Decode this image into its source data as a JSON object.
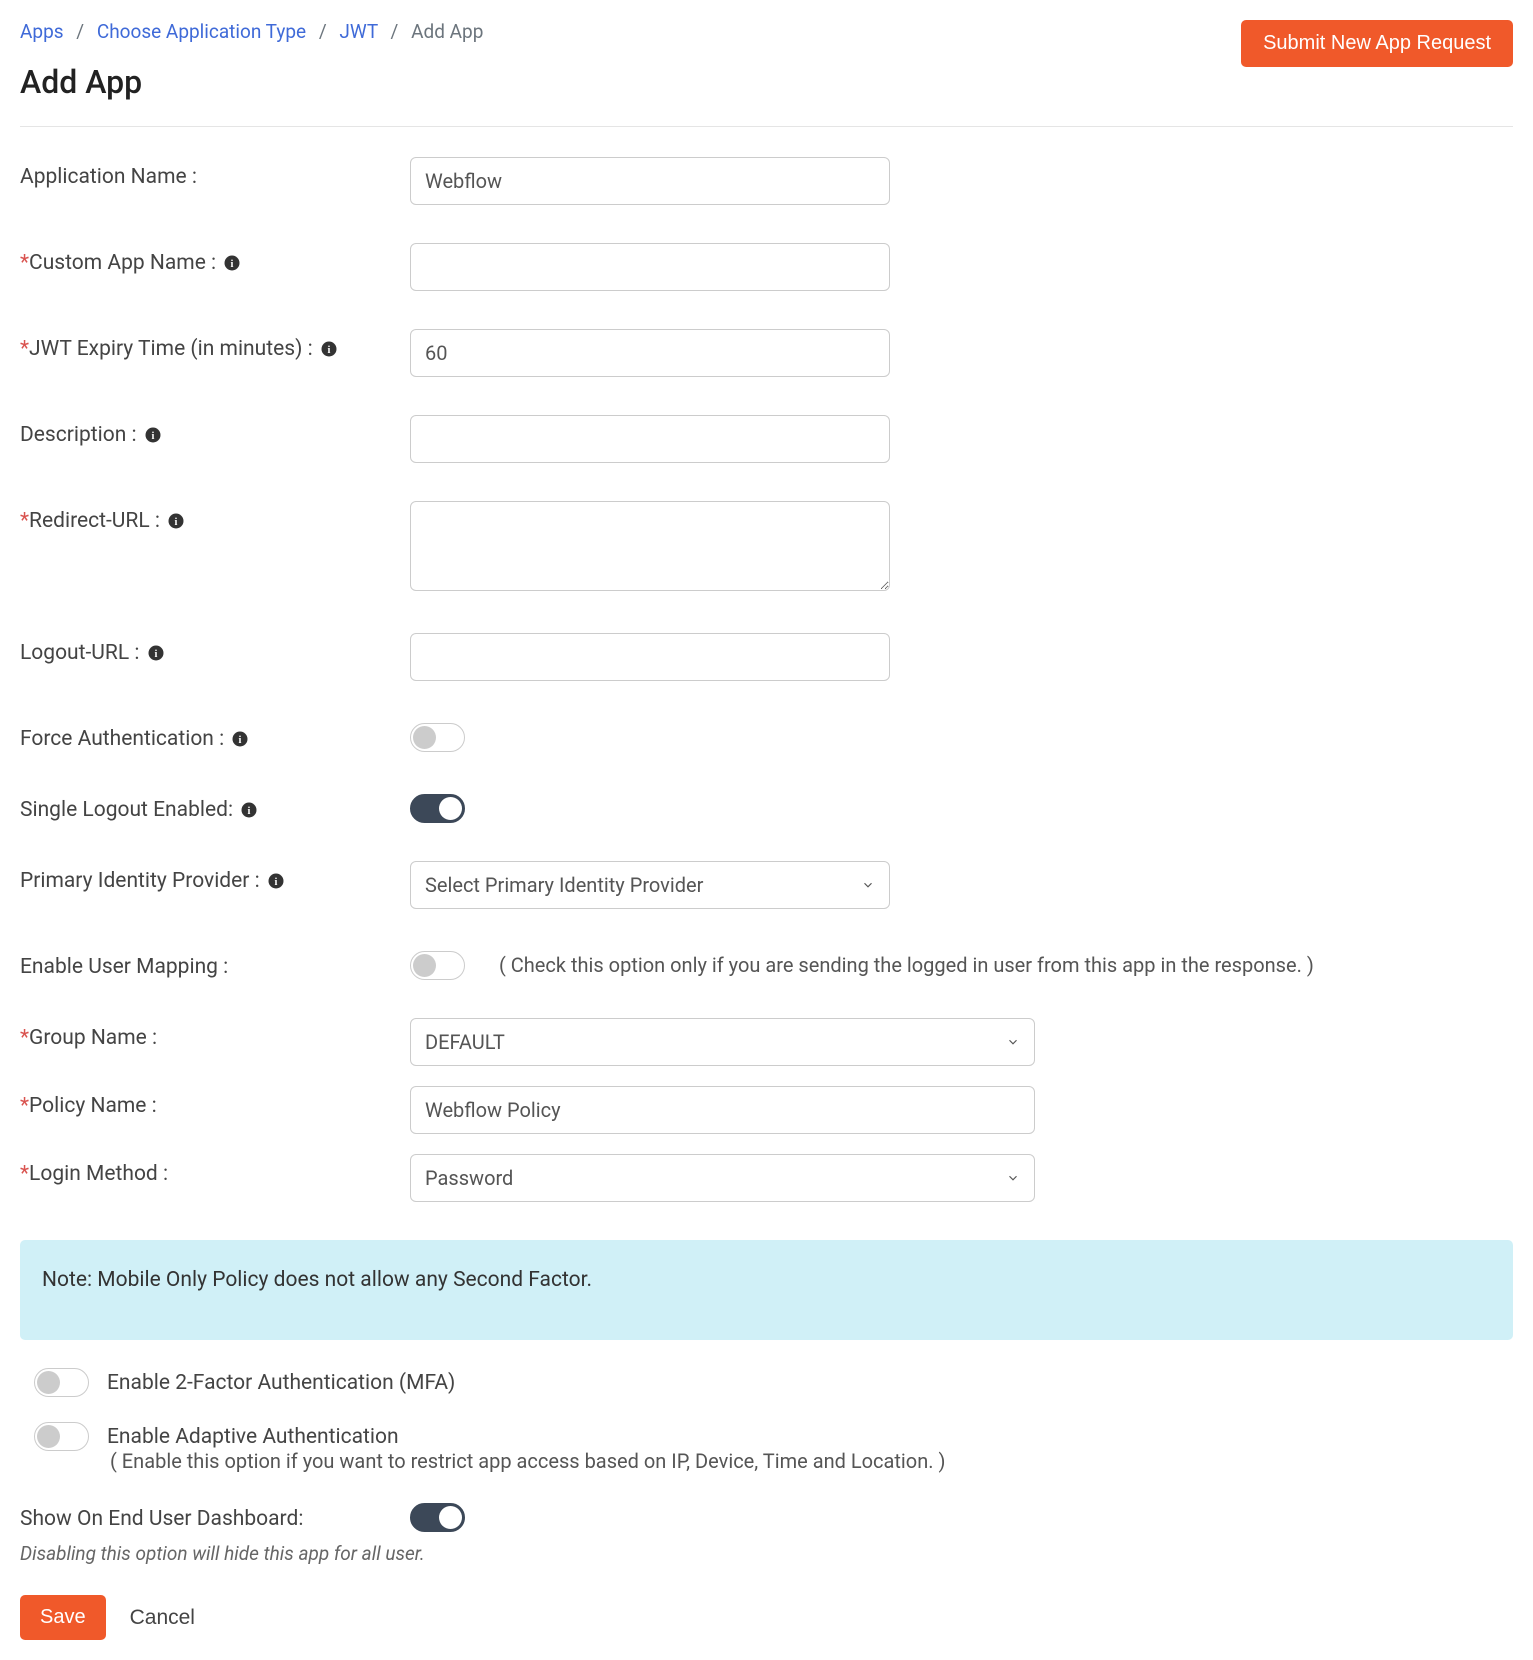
{
  "breadcrumb": {
    "apps": "Apps",
    "choose": "Choose Application Type",
    "jwt": "JWT",
    "current": "Add App"
  },
  "header": {
    "submit_btn": "Submit New App Request",
    "page_title": "Add App"
  },
  "form": {
    "app_name_label": "Application Name :",
    "app_name_value": "Webflow",
    "custom_app_name_label": "Custom App Name :",
    "custom_app_name_value": "",
    "jwt_expiry_label": "JWT Expiry Time (in minutes) :",
    "jwt_expiry_value": "60",
    "description_label": "Description :",
    "description_value": "",
    "redirect_url_label": "Redirect-URL :",
    "redirect_url_value": "",
    "logout_url_label": "Logout-URL :",
    "logout_url_value": "",
    "force_auth_label": "Force Authentication :",
    "single_logout_label": "Single Logout Enabled:",
    "primary_idp_label": "Primary Identity Provider :",
    "primary_idp_value": "Select Primary Identity Provider",
    "enable_user_mapping_label": "Enable User Mapping :",
    "enable_user_mapping_hint": "( Check this option only if you are sending the logged in user from this app in the response. )",
    "group_name_label": "Group Name :",
    "group_name_value": "DEFAULT",
    "policy_name_label": "Policy Name :",
    "policy_name_value": "Webflow Policy",
    "login_method_label": "Login Method :",
    "login_method_value": "Password"
  },
  "note": "Note: Mobile Only Policy does not allow any Second Factor.",
  "toggles": {
    "mfa_label": "Enable 2-Factor Authentication (MFA)",
    "adaptive_label": "Enable Adaptive Authentication",
    "adaptive_hint": "( Enable this option if you want to restrict app access based on IP, Device, Time and Location. )",
    "dashboard_label": "Show On End User Dashboard:",
    "dashboard_hint": "Disabling this option will hide this app for all user."
  },
  "buttons": {
    "save": "Save",
    "cancel": "Cancel"
  }
}
